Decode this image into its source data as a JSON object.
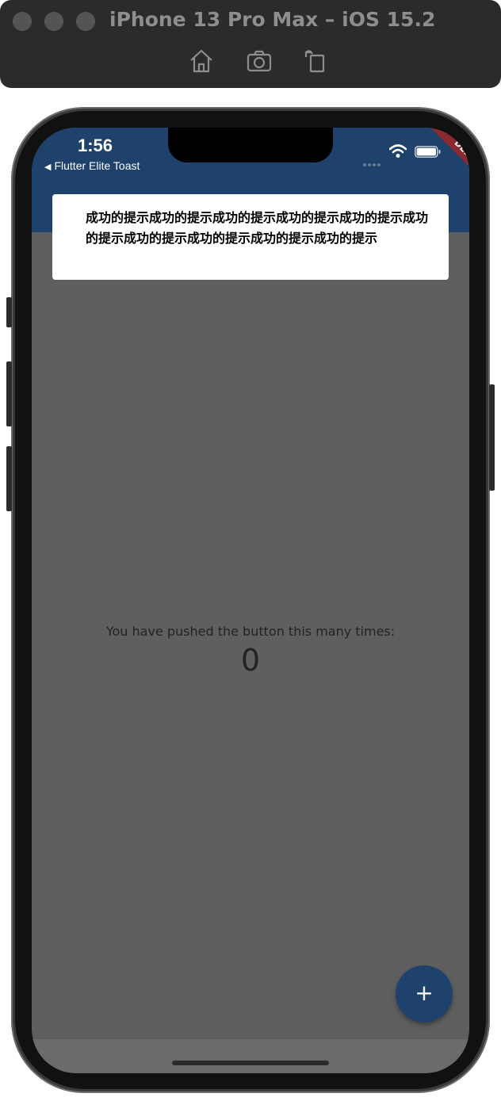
{
  "simulator": {
    "title": "iPhone 13 Pro Max – iOS 15.2",
    "toolbar": {
      "home": "home-icon",
      "screenshot": "camera-icon",
      "rotate": "rotate-icon"
    }
  },
  "status_bar": {
    "time": "1:56",
    "back_app": "Flutter Elite Toast",
    "debug_banner": "DEBUG"
  },
  "toast": {
    "message": "成功的提示成功的提示成功的提示成功的提示成功的提示成功的提示成功的提示成功的提示成功的提示成功的提示"
  },
  "body": {
    "label": "You have pushed the button this many times:",
    "counter": "0"
  },
  "fab": {
    "label": "+"
  },
  "colors": {
    "appbar": "#1e426b",
    "scrim": "#5f5f5f",
    "fab": "#1e426b",
    "debug": "#8a2a2f"
  }
}
